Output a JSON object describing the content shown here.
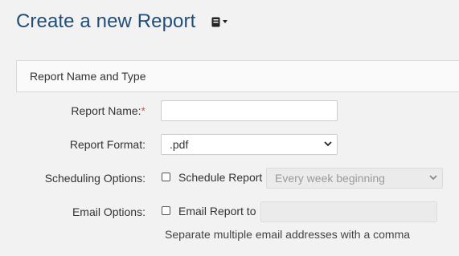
{
  "header": {
    "title": "Create a new Report",
    "menu_icon": "document-icon"
  },
  "panel": {
    "heading": "Report Name and Type"
  },
  "form": {
    "report_name": {
      "label": "Report Name:",
      "required_marker": "*",
      "value": ""
    },
    "report_format": {
      "label": "Report Format:",
      "selected": ".pdf"
    },
    "scheduling": {
      "label": "Scheduling Options:",
      "checkbox_label": "Schedule Report",
      "checked": false,
      "schedule_selected": "Every week beginning",
      "schedule_disabled": true
    },
    "email": {
      "label": "Email Options:",
      "checkbox_label": "Email Report to",
      "checked": false,
      "value": "",
      "disabled": true,
      "help_text": "Separate multiple email addresses with a comma"
    }
  },
  "colors": {
    "title": "#1f4e79",
    "required": "#d9534f",
    "background": "#f2f2f2",
    "disabled_field": "#ebebeb"
  }
}
